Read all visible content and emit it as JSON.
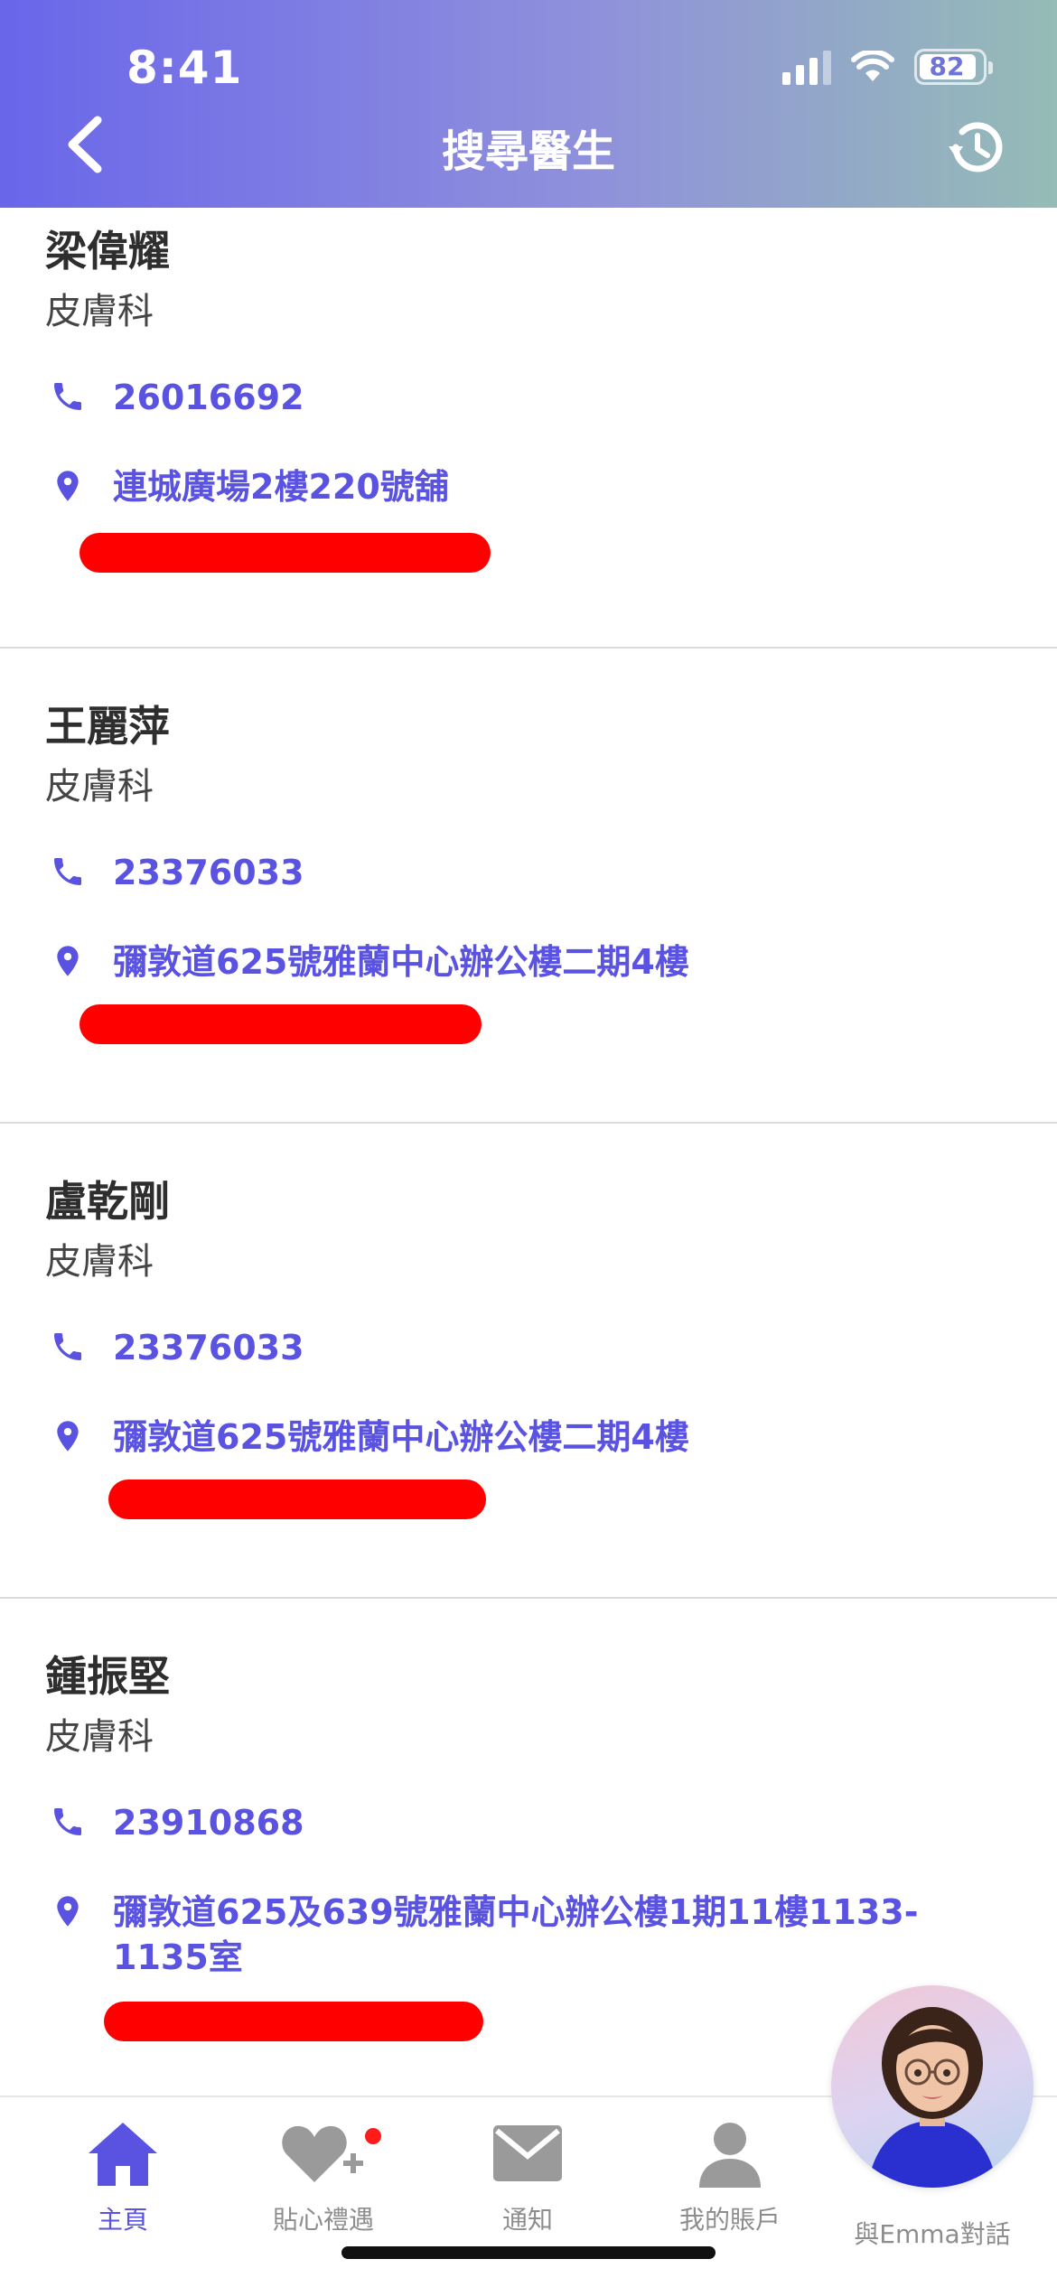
{
  "status_bar": {
    "time": "8:41",
    "battery": "82"
  },
  "header": {
    "title": "搜尋醫生",
    "back_icon": "chevron-left-icon",
    "history_icon": "history-icon"
  },
  "doctors": [
    {
      "name": "梁偉耀",
      "specialty": "皮膚科",
      "phone": "26016692",
      "address": "連城廣場2樓220號舖"
    },
    {
      "name": "王麗萍",
      "specialty": "皮膚科",
      "phone": "23376033",
      "address": "彌敦道625號雅蘭中心辦公樓二期4樓"
    },
    {
      "name": "盧乾剛",
      "specialty": "皮膚科",
      "phone": "23376033",
      "address": "彌敦道625號雅蘭中心辦公樓二期4樓"
    },
    {
      "name": "鍾振堅",
      "specialty": "皮膚科",
      "phone": "23910868",
      "address": "彌敦道625及639號雅蘭中心辦公樓1期11樓1133-1135室"
    }
  ],
  "tabs": [
    {
      "label": "主頁",
      "icon": "home-icon",
      "active": true
    },
    {
      "label": "貼心禮遇",
      "icon": "heart-plus-icon",
      "active": false,
      "has_badge": true
    },
    {
      "label": "通知",
      "icon": "mail-icon",
      "active": false
    },
    {
      "label": "我的賬戶",
      "icon": "person-icon",
      "active": false
    },
    {
      "label": "與Emma對話",
      "icon": "emma-avatar",
      "active": false
    }
  ],
  "colors": {
    "accent": "#5a52e0",
    "header_start": "#6a66ea",
    "header_end": "#95bcb6",
    "redaction": "#ff0000"
  }
}
